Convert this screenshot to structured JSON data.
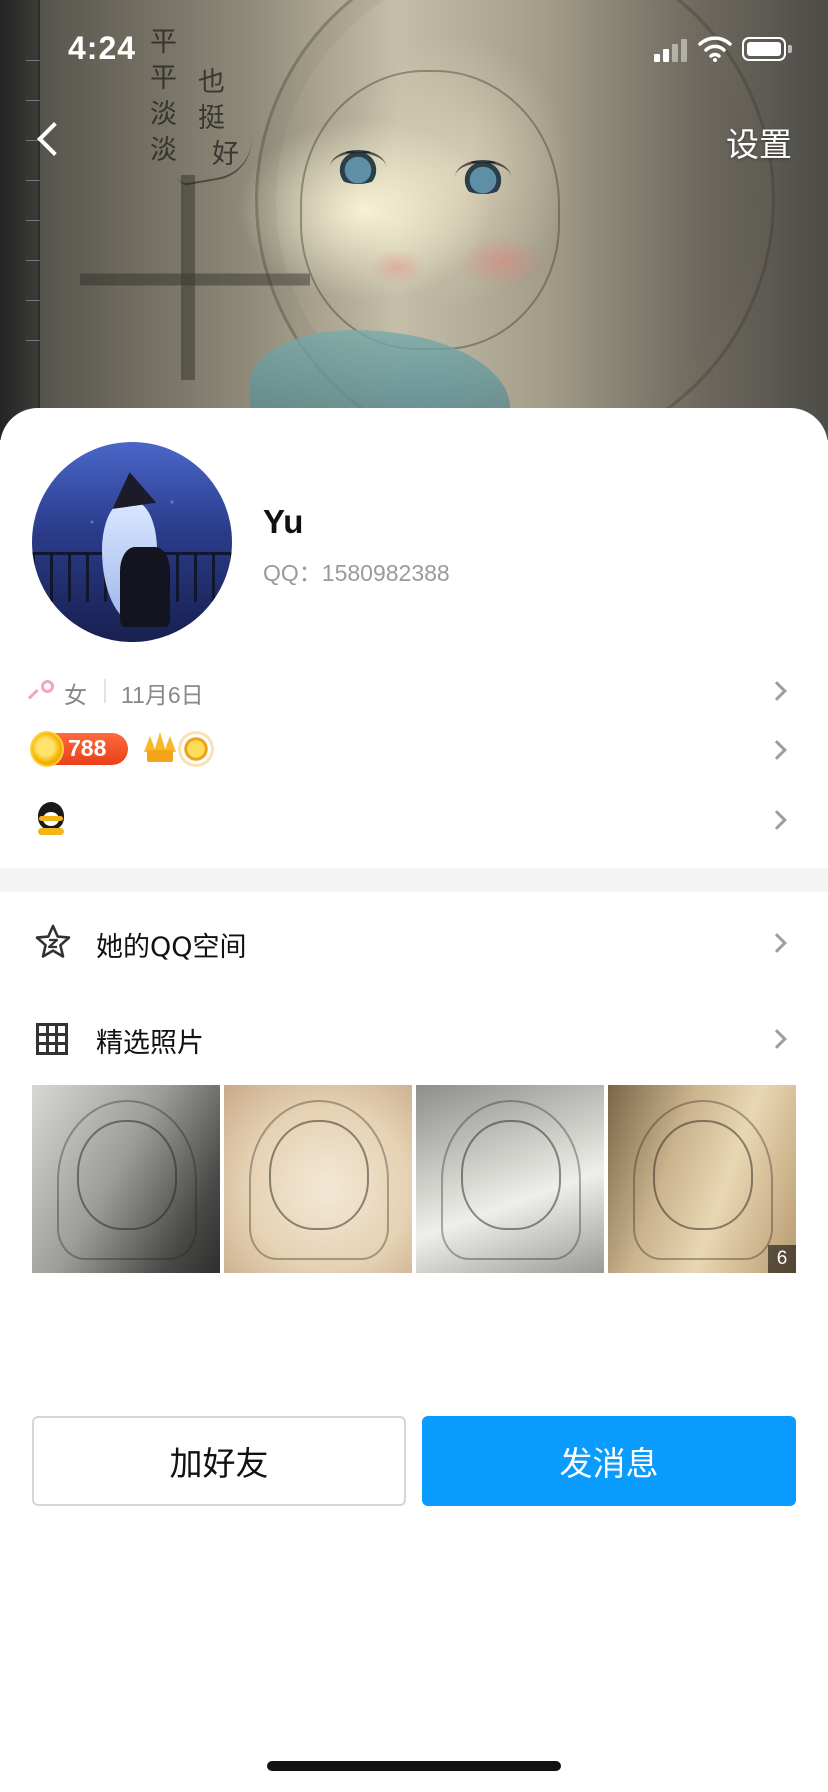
{
  "status_bar": {
    "time": "4:24"
  },
  "header": {
    "cover_handwriting": [
      "平平",
      "淡淡",
      "也挺",
      "好"
    ],
    "settings_label": "设置"
  },
  "profile": {
    "name": "Yu",
    "qq_id": "QQ：1580982388",
    "gender": "女",
    "birthday": "11月6日",
    "coin_level": "788"
  },
  "menu": {
    "qzone_label": "她的QQ空间",
    "photos_label": "精选照片"
  },
  "photos": {
    "count_badge": "6"
  },
  "actions": {
    "add_friend_label": "加好友",
    "send_message_label": "发消息"
  },
  "colors": {
    "accent": "#0a9bff",
    "coin_badge": "#e8401c",
    "secondary_text": "#888888"
  }
}
